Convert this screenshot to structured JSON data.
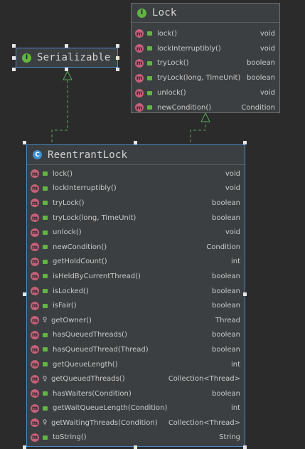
{
  "colors": {
    "background": "#2b2b2b",
    "box": "#3c3f41",
    "selection": "#4a88c7",
    "arrow": "#5aa65a",
    "method_icon": "#c4607a",
    "interface_icon": "#62b543",
    "class_icon": "#3d8fd1"
  },
  "serializable": {
    "kind_letter": "I",
    "title": "Serializable"
  },
  "lock": {
    "kind_letter": "I",
    "title": "Lock",
    "methods": [
      {
        "name": "lock()",
        "type": "void",
        "visibility": "public"
      },
      {
        "name": "lockInterruptibly()",
        "type": "void",
        "visibility": "public"
      },
      {
        "name": "tryLock()",
        "type": "boolean",
        "visibility": "public"
      },
      {
        "name": "tryLock(long, TimeUnit)",
        "type": "boolean",
        "visibility": "public"
      },
      {
        "name": "unlock()",
        "type": "void",
        "visibility": "public"
      },
      {
        "name": "newCondition()",
        "type": "Condition",
        "visibility": "public"
      }
    ]
  },
  "reentrant": {
    "kind_letter": "C",
    "title": "ReentrantLock",
    "methods": [
      {
        "name": "lock()",
        "type": "void",
        "visibility": "public"
      },
      {
        "name": "lockInterruptibly()",
        "type": "void",
        "visibility": "public"
      },
      {
        "name": "tryLock()",
        "type": "boolean",
        "visibility": "public"
      },
      {
        "name": "tryLock(long, TimeUnit)",
        "type": "boolean",
        "visibility": "public"
      },
      {
        "name": "unlock()",
        "type": "void",
        "visibility": "public"
      },
      {
        "name": "newCondition()",
        "type": "Condition",
        "visibility": "public"
      },
      {
        "name": "getHoldCount()",
        "type": "int",
        "visibility": "public"
      },
      {
        "name": "isHeldByCurrentThread()",
        "type": "boolean",
        "visibility": "public"
      },
      {
        "name": "isLocked()",
        "type": "boolean",
        "visibility": "public"
      },
      {
        "name": "isFair()",
        "type": "boolean",
        "visibility": "public"
      },
      {
        "name": "getOwner()",
        "type": "Thread",
        "visibility": "protected"
      },
      {
        "name": "hasQueuedThreads()",
        "type": "boolean",
        "visibility": "public"
      },
      {
        "name": "hasQueuedThread(Thread)",
        "type": "boolean",
        "visibility": "public"
      },
      {
        "name": "getQueueLength()",
        "type": "int",
        "visibility": "public"
      },
      {
        "name": "getQueuedThreads()",
        "type": "Collection<Thread>",
        "visibility": "protected"
      },
      {
        "name": "hasWaiters(Condition)",
        "type": "boolean",
        "visibility": "public"
      },
      {
        "name": "getWaitQueueLength(Condition)",
        "type": "int",
        "visibility": "public"
      },
      {
        "name": "getWaitingThreads(Condition)",
        "type": "Collection<Thread>",
        "visibility": "protected"
      },
      {
        "name": "toString()",
        "type": "String",
        "visibility": "public"
      }
    ]
  },
  "icons": {
    "method": "method-icon",
    "public": "public-visibility-icon",
    "protected": "protected-visibility-icon",
    "interface": "interface-icon",
    "class": "class-icon"
  }
}
